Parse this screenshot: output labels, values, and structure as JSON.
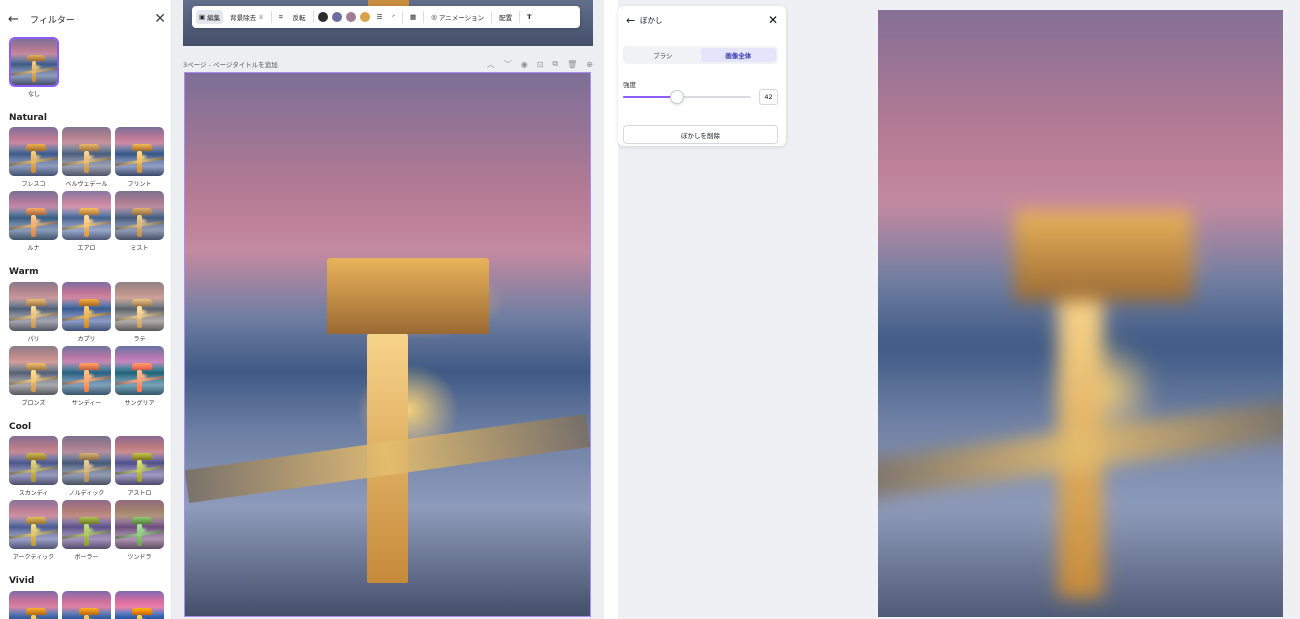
{
  "filter_panel": {
    "title": "フィルター",
    "none_label": "なし",
    "sections": [
      {
        "title": "Natural",
        "items": [
          "フレスコ",
          "ベルヴェデール",
          "フリント",
          "ルナ",
          "エアロ",
          "ミスト"
        ]
      },
      {
        "title": "Warm",
        "items": [
          "パリ",
          "カプリ",
          "ラテ",
          "ブロンズ",
          "サンディー",
          "サングリア"
        ]
      },
      {
        "title": "Cool",
        "items": [
          "スカンディ",
          "ノルディック",
          "アストロ",
          "アークティック",
          "ボーラー",
          "ツンドラ"
        ]
      },
      {
        "title": "Vivid",
        "items": []
      }
    ]
  },
  "toolbar": {
    "edit_label": "編集",
    "bg_remove_label": "背景除去",
    "flip_label": "反転",
    "animation_label": "アニメーション",
    "position_label": "配置",
    "swatches": [
      "#2b2b2b",
      "#6b6fa0",
      "#a07e95",
      "#d8a24a"
    ]
  },
  "page": {
    "title": "3ページ - ページタイトルを追加"
  },
  "blur_panel": {
    "title": "ぼかし",
    "tabs": [
      "ブラシ",
      "画像全体"
    ],
    "active_tab": 1,
    "strength_label": "強度",
    "strength_value": "42",
    "strength_fraction": 0.42,
    "remove_label": "ぼかしを削除"
  },
  "colors": {
    "accent": "#8b5cf6",
    "selection_border": "#a98cf5"
  }
}
